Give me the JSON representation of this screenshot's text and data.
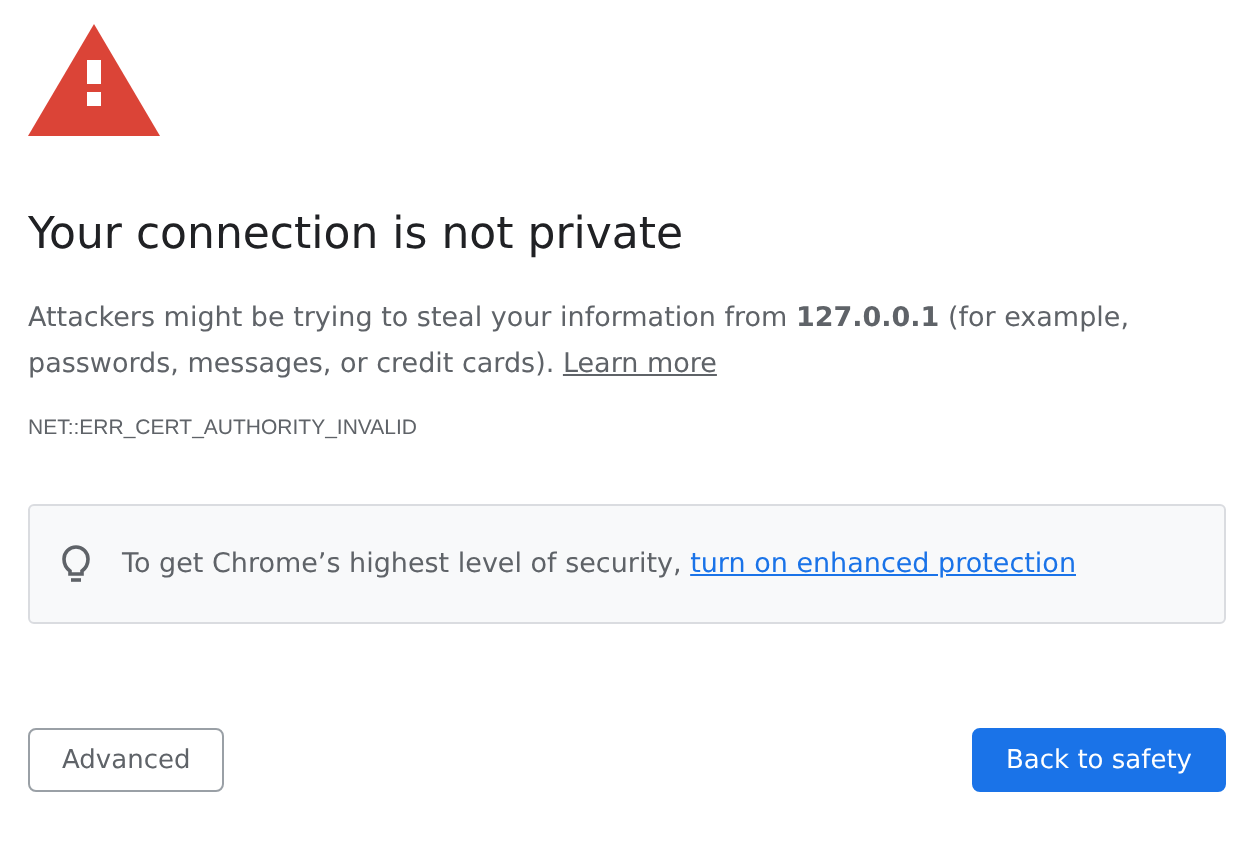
{
  "heading": "Your connection is not private",
  "message": {
    "text": "Attackers might be trying to steal your information from **127.0.0.1** (for example, passwords, messages, or credit cards).",
    "link": "Learn more"
  },
  "error_code": "NET::ERR_CERT_AUTHORITY_INVALID",
  "tip": {
    "text": "To get Chrome’s highest level of security,",
    "link": "turn on enhanced protection"
  },
  "buttons": [
    {
      "label": "Advanced",
      "kind": "secondary"
    },
    {
      "label": "Back to safety",
      "kind": "primary"
    }
  ]
}
